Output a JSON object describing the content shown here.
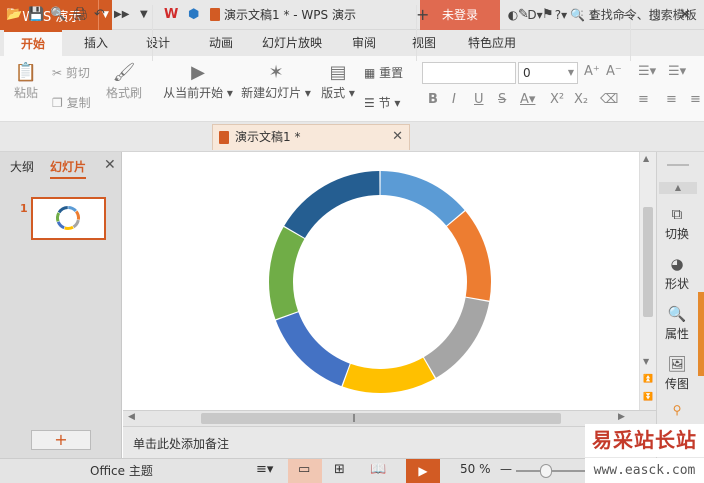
{
  "app": {
    "logo_text": "WPS 演示",
    "title": "演示文稿1 * - WPS 演示",
    "login": "未登录"
  },
  "tabs": [
    {
      "label": "开始"
    },
    {
      "label": "插入"
    },
    {
      "label": "设计"
    },
    {
      "label": "动画"
    },
    {
      "label": "幻灯片放映"
    },
    {
      "label": "审阅"
    },
    {
      "label": "视图"
    },
    {
      "label": "特色应用"
    }
  ],
  "ribbon": {
    "paste": "粘贴",
    "cut": "剪切",
    "copy": "复制",
    "format_painter": "格式刷",
    "from_current": "从当前开始",
    "new_slide": "新建幻灯片",
    "layout": "版式",
    "reset": "重置",
    "section": "节",
    "font_size_value": "0"
  },
  "quickbar": {
    "doc_tab": "演示文稿1 *",
    "search": "查找命令、搜索模板"
  },
  "left_panel": {
    "tab_outline": "大纲",
    "tab_slides": "幻灯片",
    "slide_number": "1",
    "add_button": "+"
  },
  "notes": {
    "placeholder": "单击此处添加备注"
  },
  "right_panel": {
    "items": [
      {
        "label": "切换",
        "icon": "transition-icon"
      },
      {
        "label": "形状",
        "icon": "shapes-icon"
      },
      {
        "label": "属性",
        "icon": "properties-icon"
      },
      {
        "label": "传图",
        "icon": "upload-image-icon"
      }
    ]
  },
  "status": {
    "theme": "Office 主题",
    "zoom": "50 %"
  },
  "watermark": {
    "line1": "易采站长站",
    "line2": "www.easck.com"
  },
  "colors": {
    "accent": "#d25b24",
    "login_bg": "#e06a50"
  },
  "slide_chart": {
    "type": "donut",
    "segments": [
      {
        "color": "#5b9bd5",
        "fraction": 0.1389
      },
      {
        "color": "#ed7d31",
        "fraction": 0.1389
      },
      {
        "color": "#a5a5a5",
        "fraction": 0.1389
      },
      {
        "color": "#ffc000",
        "fraction": 0.1389
      },
      {
        "color": "#4472c4",
        "fraction": 0.1389
      },
      {
        "color": "#70ad47",
        "fraction": 0.1389
      },
      {
        "color": "#255e91",
        "fraction": 0.1666
      }
    ]
  }
}
